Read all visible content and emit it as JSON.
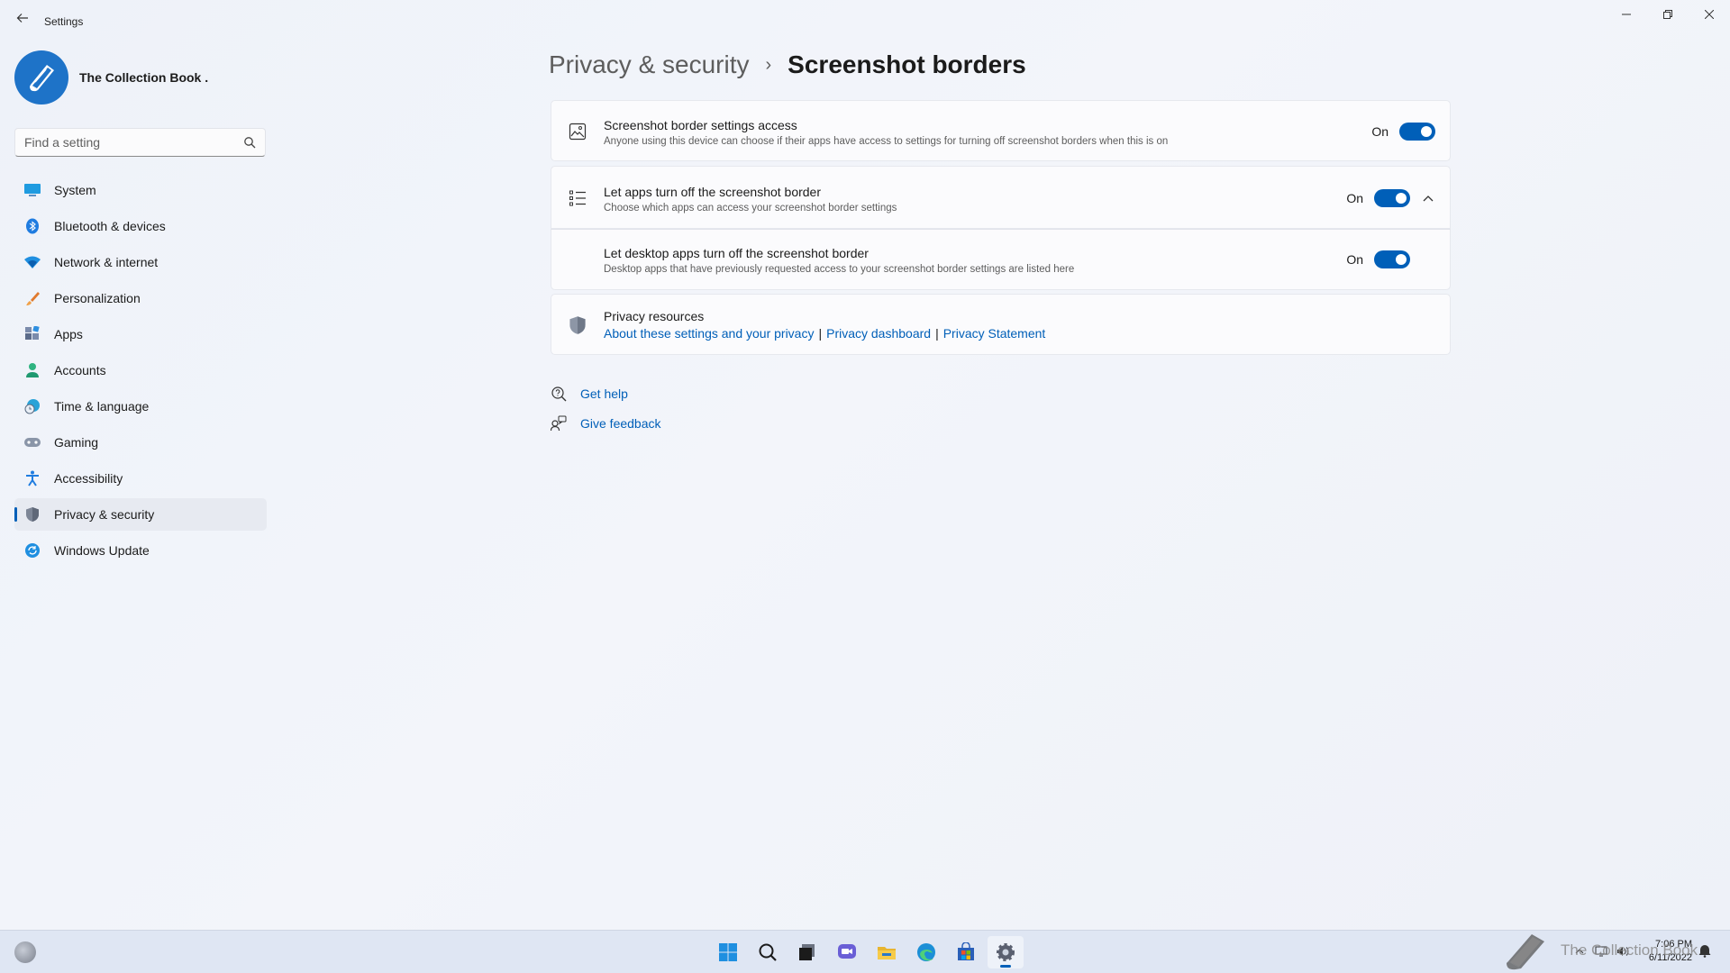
{
  "window": {
    "back_icon": "back-arrow-icon",
    "title": "Settings",
    "minimize_icon": "minimize-icon",
    "maximize_icon": "restore-icon",
    "close_icon": "close-icon"
  },
  "profile": {
    "name": "The Collection Book ."
  },
  "search": {
    "placeholder": "Find a setting"
  },
  "sidebar": {
    "items": [
      {
        "label": "System",
        "icon": "system-icon"
      },
      {
        "label": "Bluetooth & devices",
        "icon": "bluetooth-icon"
      },
      {
        "label": "Network & internet",
        "icon": "wifi-icon"
      },
      {
        "label": "Personalization",
        "icon": "brush-icon"
      },
      {
        "label": "Apps",
        "icon": "apps-icon"
      },
      {
        "label": "Accounts",
        "icon": "person-icon"
      },
      {
        "label": "Time & language",
        "icon": "globe-clock-icon"
      },
      {
        "label": "Gaming",
        "icon": "gamepad-icon"
      },
      {
        "label": "Accessibility",
        "icon": "accessibility-icon"
      },
      {
        "label": "Privacy & security",
        "icon": "shield-icon",
        "selected": true
      },
      {
        "label": "Windows Update",
        "icon": "update-icon"
      }
    ]
  },
  "breadcrumb": {
    "parent": "Privacy & security",
    "separator": "›",
    "current": "Screenshot borders"
  },
  "settings": {
    "access": {
      "title": "Screenshot border settings access",
      "description": "Anyone using this device can choose if their apps have access to settings for turning off screenshot borders when this is on",
      "state": "On",
      "enabled": true
    },
    "apps": {
      "title": "Let apps turn off the screenshot border",
      "description": "Choose which apps can access your screenshot border settings",
      "state": "On",
      "enabled": true,
      "expanded": true
    },
    "desktop_apps": {
      "title": "Let desktop apps turn off the screenshot border",
      "description": "Desktop apps that have previously requested access to your screenshot border settings are listed here",
      "state": "On",
      "enabled": true
    }
  },
  "privacy_resources": {
    "title": "Privacy resources",
    "links": {
      "about": "About these settings and your privacy",
      "separator": "|",
      "dashboard": "Privacy dashboard",
      "statement": "Privacy Statement"
    }
  },
  "help": {
    "get_help": "Get help",
    "give_feedback": "Give feedback"
  },
  "taskbar": {
    "apps": [
      "start-icon",
      "search-icon",
      "task-view-icon",
      "chat-icon",
      "file-explorer-icon",
      "edge-icon",
      "store-icon",
      "settings-icon"
    ],
    "watermark": "The Collection Book",
    "time": "7:06 PM",
    "date": "6/11/2022"
  },
  "colors": {
    "accent": "#005fb8",
    "background": "#f3f5fa",
    "card": "#fbfbfd"
  }
}
